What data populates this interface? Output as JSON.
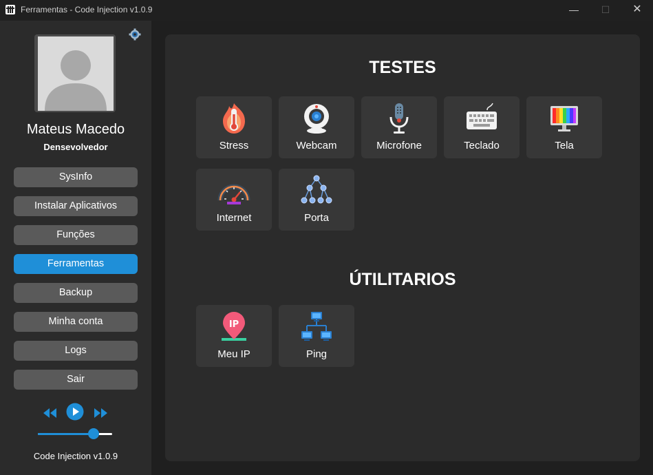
{
  "window": {
    "title": "Ferramentas - Code Injection v1.0.9",
    "minimize": "—",
    "maximize": "☐",
    "close": "✕"
  },
  "sidebar": {
    "user_name": "Mateus Macedo",
    "user_role": "Densevolvedor",
    "nav": [
      {
        "label": "SysInfo",
        "active": false
      },
      {
        "label": "Instalar Aplicativos",
        "active": false
      },
      {
        "label": "Funções",
        "active": false
      },
      {
        "label": "Ferramentas",
        "active": true
      },
      {
        "label": "Backup",
        "active": false
      },
      {
        "label": "Minha conta",
        "active": false
      },
      {
        "label": "Logs",
        "active": false
      },
      {
        "label": "Sair",
        "active": false
      }
    ],
    "volume": 0.75,
    "version": "Code Injection v1.0.9"
  },
  "main": {
    "tests_title": "TESTES",
    "tests": [
      {
        "label": "Stress",
        "icon": "thermometer-fire-icon"
      },
      {
        "label": "Webcam",
        "icon": "webcam-icon"
      },
      {
        "label": "Microfone",
        "icon": "microphone-icon"
      },
      {
        "label": "Teclado",
        "icon": "keyboard-icon"
      },
      {
        "label": "Tela",
        "icon": "monitor-icon"
      },
      {
        "label": "Internet",
        "icon": "speedometer-icon"
      },
      {
        "label": "Porta",
        "icon": "network-tree-icon"
      }
    ],
    "utils_title": "ÚTILITARIOS",
    "utils": [
      {
        "label": "Meu IP",
        "icon": "ip-pin-icon"
      },
      {
        "label": "Ping",
        "icon": "network-computers-icon"
      }
    ]
  },
  "colors": {
    "accent": "#1f8fd8",
    "button": "#5a5a5a",
    "panel": "#2b2b2b",
    "tile": "#373737"
  }
}
